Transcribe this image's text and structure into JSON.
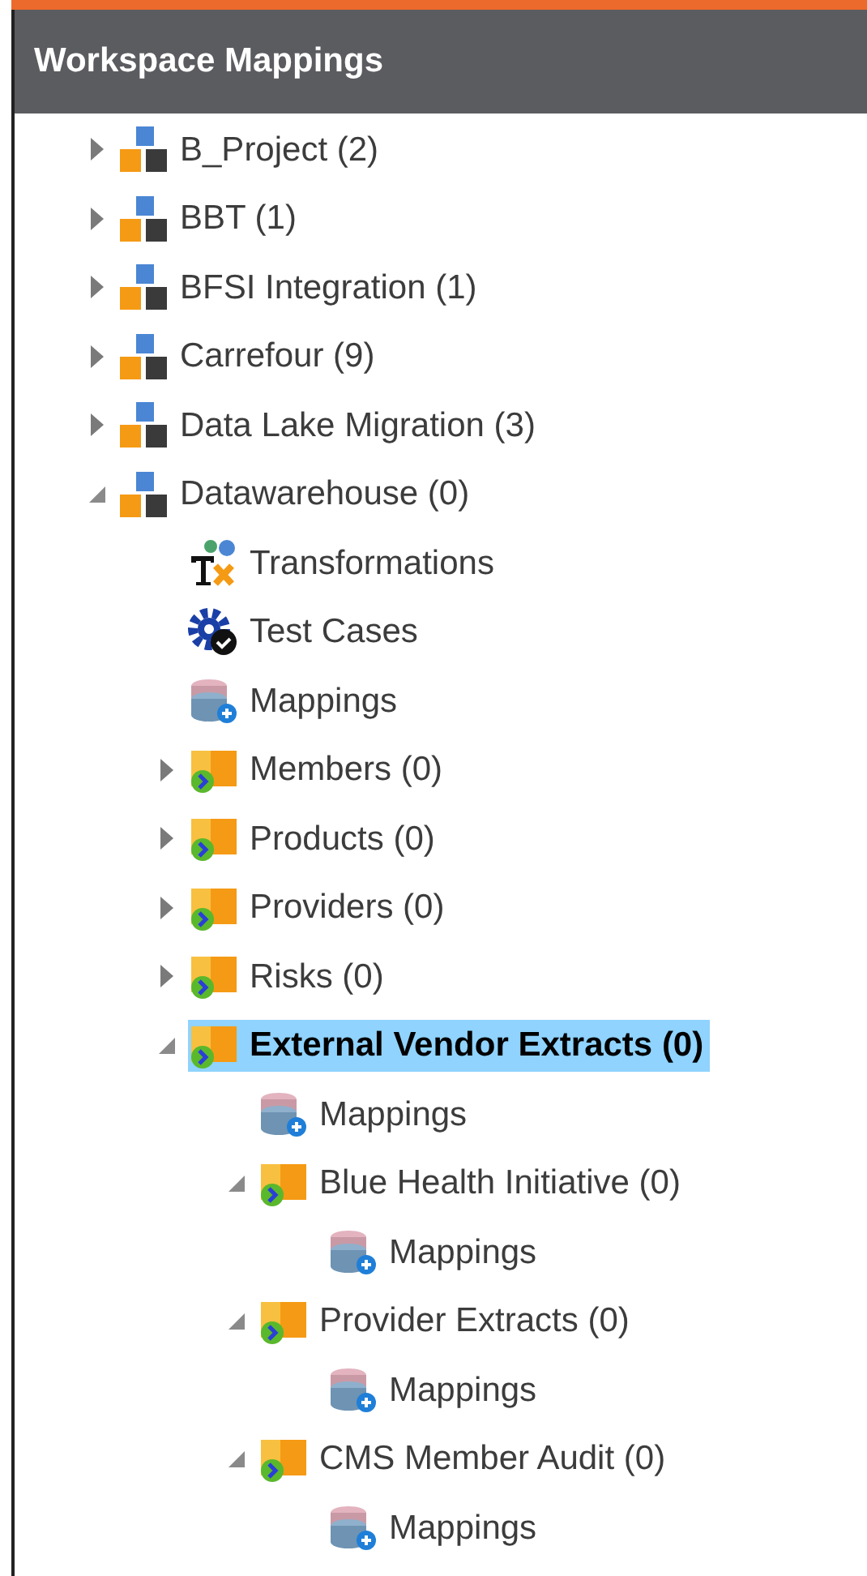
{
  "panel": {
    "title": "Workspace Mappings"
  },
  "tree": [
    {
      "kind": "project",
      "label": "B_Project (2)",
      "expanded": false,
      "selected": false
    },
    {
      "kind": "project",
      "label": "BBT (1)",
      "expanded": false,
      "selected": false
    },
    {
      "kind": "project",
      "label": "BFSI Integration (1)",
      "expanded": false,
      "selected": false
    },
    {
      "kind": "project",
      "label": "Carrefour (9)",
      "expanded": false,
      "selected": false
    },
    {
      "kind": "project",
      "label": "Data Lake Migration (3)",
      "expanded": false,
      "selected": false
    },
    {
      "kind": "project",
      "label": "Datawarehouse (0)",
      "expanded": true,
      "selected": false,
      "children": [
        {
          "kind": "transformations",
          "label": "Transformations",
          "selected": false
        },
        {
          "kind": "test_cases",
          "label": "Test Cases",
          "selected": false
        },
        {
          "kind": "mappings",
          "label": "Mappings",
          "selected": false
        },
        {
          "kind": "folder",
          "label": "Members (0)",
          "expanded": false,
          "selected": false
        },
        {
          "kind": "folder",
          "label": "Products (0)",
          "expanded": false,
          "selected": false
        },
        {
          "kind": "folder",
          "label": "Providers (0)",
          "expanded": false,
          "selected": false
        },
        {
          "kind": "folder",
          "label": "Risks (0)",
          "expanded": false,
          "selected": false
        },
        {
          "kind": "folder",
          "label": "External Vendor Extracts (0)",
          "expanded": true,
          "selected": true,
          "children": [
            {
              "kind": "mappings",
              "label": "Mappings",
              "selected": false
            },
            {
              "kind": "folder",
              "label": "Blue Health Initiative (0)",
              "expanded": true,
              "selected": false,
              "children": [
                {
                  "kind": "mappings",
                  "label": "Mappings",
                  "selected": false
                }
              ]
            },
            {
              "kind": "folder",
              "label": "Provider Extracts (0)",
              "expanded": true,
              "selected": false,
              "children": [
                {
                  "kind": "mappings",
                  "label": "Mappings",
                  "selected": false
                }
              ]
            },
            {
              "kind": "folder",
              "label": "CMS Member Audit (0)",
              "expanded": true,
              "selected": false,
              "children": [
                {
                  "kind": "mappings",
                  "label": "Mappings",
                  "selected": false
                }
              ]
            }
          ]
        }
      ]
    }
  ]
}
